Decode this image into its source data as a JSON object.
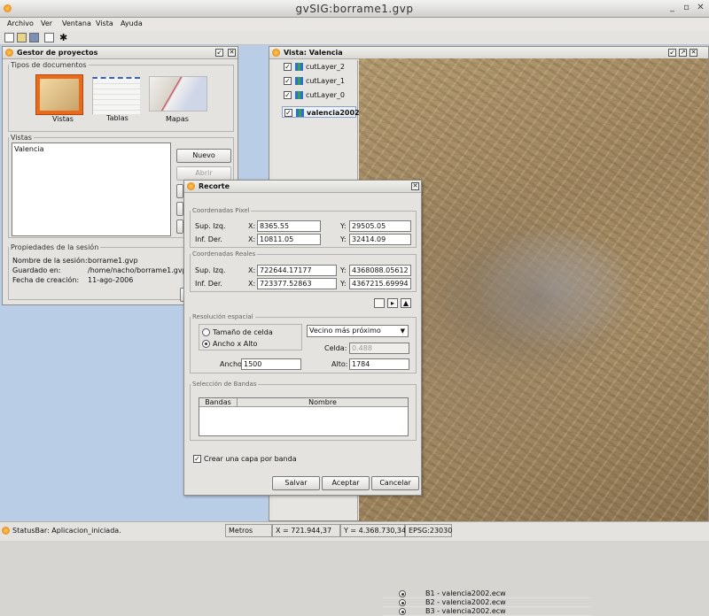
{
  "window": {
    "title": "gvSIG:borrame1.gvp"
  },
  "menu": [
    "Archivo",
    "Ver",
    "Ventana",
    "Vista",
    "Ayuda"
  ],
  "project_manager": {
    "title": "Gestor de proyectos",
    "doc_types_label": "Tipos de documentos",
    "doc_types": [
      "Vistas",
      "Tablas",
      "Mapas"
    ],
    "views_label": "Vistas",
    "views_list": [
      "Valencia"
    ],
    "buttons": {
      "new": "Nuevo",
      "open": "Abrir"
    },
    "session_label": "Propiedades de la sesión",
    "session": {
      "name_label": "Nombre de la sesión:",
      "name": "borrame1.gvp",
      "saved_label": "Guardado en:",
      "saved": "/home/nacho/borrame1.gvp",
      "created_label": "Fecha de creación:",
      "created": "11-ago-2006"
    }
  },
  "view_window": {
    "title": "Vista: Valencia",
    "layers": [
      {
        "name": "cutLayer_2",
        "checked": true,
        "bold": false
      },
      {
        "name": "cutLayer_1",
        "checked": true,
        "bold": false
      },
      {
        "name": "cutLayer_0",
        "checked": true,
        "bold": false
      },
      {
        "name": "valencia2002...",
        "checked": true,
        "bold": true
      }
    ]
  },
  "clip_dialog": {
    "title": "Recorte",
    "pixel_coords_label": "Coordenadas Pixel",
    "real_coords_label": "Coordenadas Reales",
    "sup_izq_label": "Sup. Izq.",
    "inf_der_label": "Inf. Der.",
    "x_label": "X:",
    "y_label": "Y:",
    "pixel": {
      "sup_izq_x": "8365.55",
      "sup_izq_y": "29505.05",
      "inf_der_x": "10811.05",
      "inf_der_y": "32414.09"
    },
    "real": {
      "sup_izq_x": "722644.17177",
      "sup_izq_y": "4368088.05612",
      "inf_der_x": "723377.52863",
      "inf_der_y": "4367215.69994"
    },
    "resolution_label": "Resolución espacial",
    "cell_size_option": "Tamaño de celda",
    "width_height_option": "Ancho x Alto",
    "interpolation": "Vecino más próximo",
    "cell_label": "Celda:",
    "cell_value": "0.488",
    "width_label": "Ancho:",
    "width_value": "1500",
    "height_label": "Alto:",
    "height_value": "1784",
    "bands_label": "Selección de Bandas",
    "bands_headers": [
      "Bandas",
      "Nombre"
    ],
    "bands": [
      "B1 - valencia2002.ecw",
      "B2 - valencia2002.ecw",
      "B3 - valencia2002.ecw"
    ],
    "one_layer_per_band": "Crear una capa por banda",
    "buttons": {
      "save": "Salvar",
      "accept": "Aceptar",
      "cancel": "Cancelar"
    }
  },
  "status": {
    "message": "StatusBar: Aplicacion_iniciada.",
    "units": "Metros",
    "x": "X = 721.944,37",
    "y": "Y = 4.368.730,34",
    "epsg": "EPSG:23030"
  }
}
